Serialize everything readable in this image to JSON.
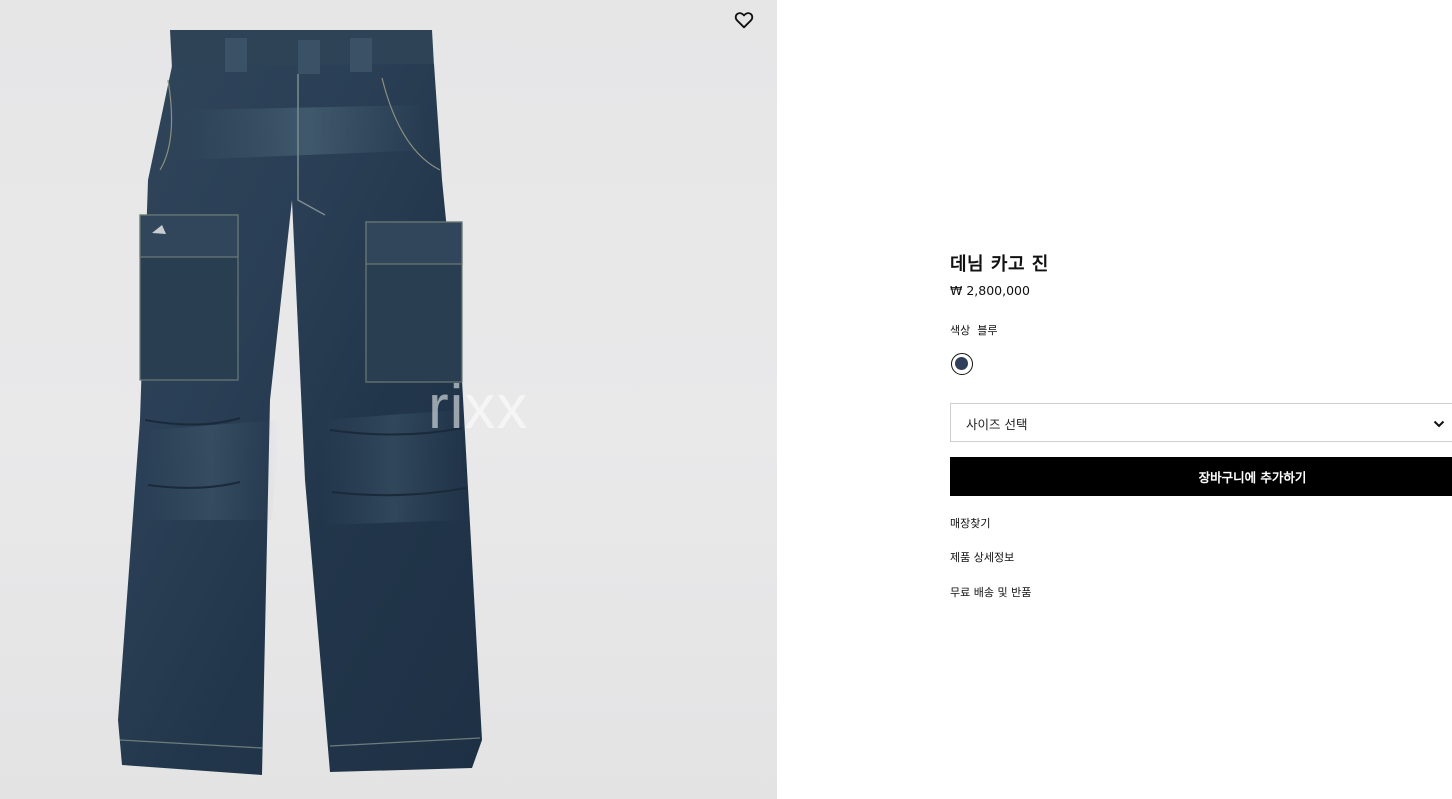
{
  "gallery": {
    "image_alt": "데님 카고 진",
    "watermark": "rixx"
  },
  "product": {
    "title": "데님 카고 진",
    "price": "₩ 2,800,000",
    "color_label": "색상",
    "color_value": "블루",
    "swatch_color": "#2f3f5a"
  },
  "size_select": {
    "placeholder": "사이즈 선택"
  },
  "actions": {
    "add_to_cart": "장바구니에 추가하기"
  },
  "links": {
    "find_store": "매장찾기",
    "product_details": "제품 상세정보",
    "shipping_returns": "무료 배송 및 반품"
  },
  "icons": {
    "wishlist": "heart-outline-icon",
    "dropdown": "chevron-down-icon"
  }
}
